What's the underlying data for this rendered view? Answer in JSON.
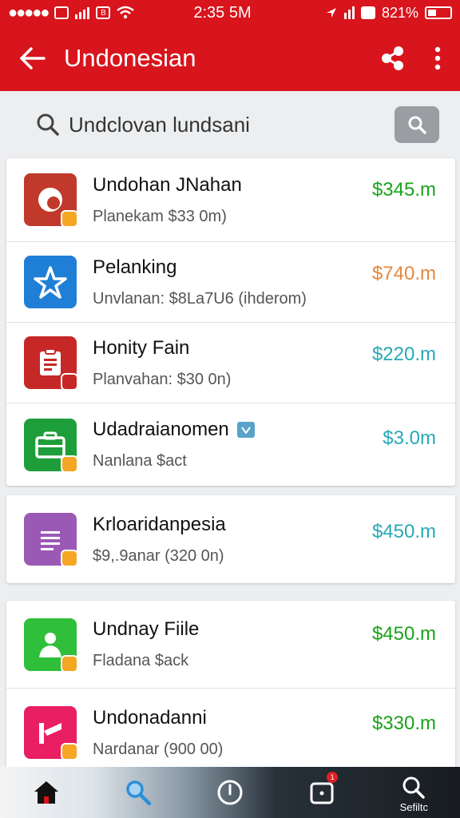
{
  "status_bar": {
    "time": "2:35 5M",
    "battery": "821%",
    "box_icon": "B"
  },
  "app_bar": {
    "title": "Undonesian",
    "back_icon": "arrow-left-icon",
    "share_icon": "share-icon",
    "more_icon": "more-vert-icon"
  },
  "search": {
    "query": "Undclovan lundsani"
  },
  "colors": {
    "brand": "#d8141c",
    "price_green": "#1aa31a",
    "price_orange": "#e8873a",
    "price_teal": "#27a9b6"
  },
  "lists": [
    {
      "items": [
        {
          "title": "Undohan JNahan",
          "subtitle": "Planekam $33 0m)",
          "price": "$345.m",
          "price_color": "#1aa31a",
          "icon": "target-icon",
          "icon_bg": "#c0392b"
        },
        {
          "title": "Pelanking",
          "subtitle": "Unvlanan: $8La7U6 (ihderom)",
          "price": "$740.m",
          "price_color": "#e8873a",
          "icon": "star-person-icon",
          "icon_bg": "#1f7fd6"
        },
        {
          "title": "Honity Fain",
          "subtitle": "Planvahan: $30 0n)",
          "price": "$220.m",
          "price_color": "#27a9b6",
          "icon": "clipboard-icon",
          "icon_bg": "#c62828"
        },
        {
          "title": "Udadraianomen",
          "subtitle": "Nanlana $act",
          "price": "$3.0m",
          "price_color": "#27a9b6",
          "icon": "briefcase-icon",
          "icon_bg": "#1e9e3a",
          "verified": true
        }
      ]
    },
    {
      "items": [
        {
          "title": "Krloaridanpesia",
          "subtitle": "$9,.9anar (320 0n)",
          "price": "$450.m",
          "price_color": "#27a9b6",
          "icon": "document-icon",
          "icon_bg": "#9b59b6"
        }
      ]
    },
    {
      "items": [
        {
          "title": "Undnay Fiile",
          "subtitle": "Fladana $ack",
          "price": "$450.m",
          "price_color": "#1aa31a",
          "icon": "person-icon",
          "icon_bg": "#2fbf3a"
        },
        {
          "title": "Undonadanni",
          "subtitle": "Nardanar (900 00)",
          "price": "$330.m",
          "price_color": "#1aa31a",
          "icon": "pointer-icon",
          "icon_bg": "#e91e63"
        }
      ]
    }
  ],
  "bottom_nav": {
    "items": [
      {
        "icon": "home-icon"
      },
      {
        "icon": "search-icon"
      },
      {
        "icon": "compass-icon"
      },
      {
        "icon": "notification-icon",
        "badge": "1"
      },
      {
        "icon": "search-icon",
        "label": "Sefiltc"
      }
    ]
  }
}
